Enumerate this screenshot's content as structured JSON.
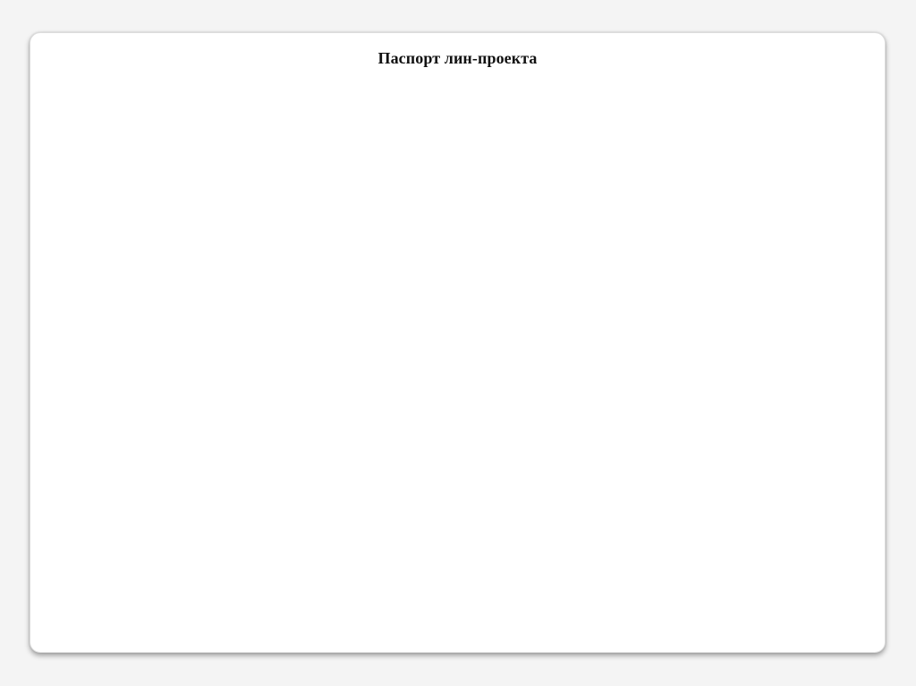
{
  "slide": {
    "title": "Паспорт лин-проекта"
  }
}
